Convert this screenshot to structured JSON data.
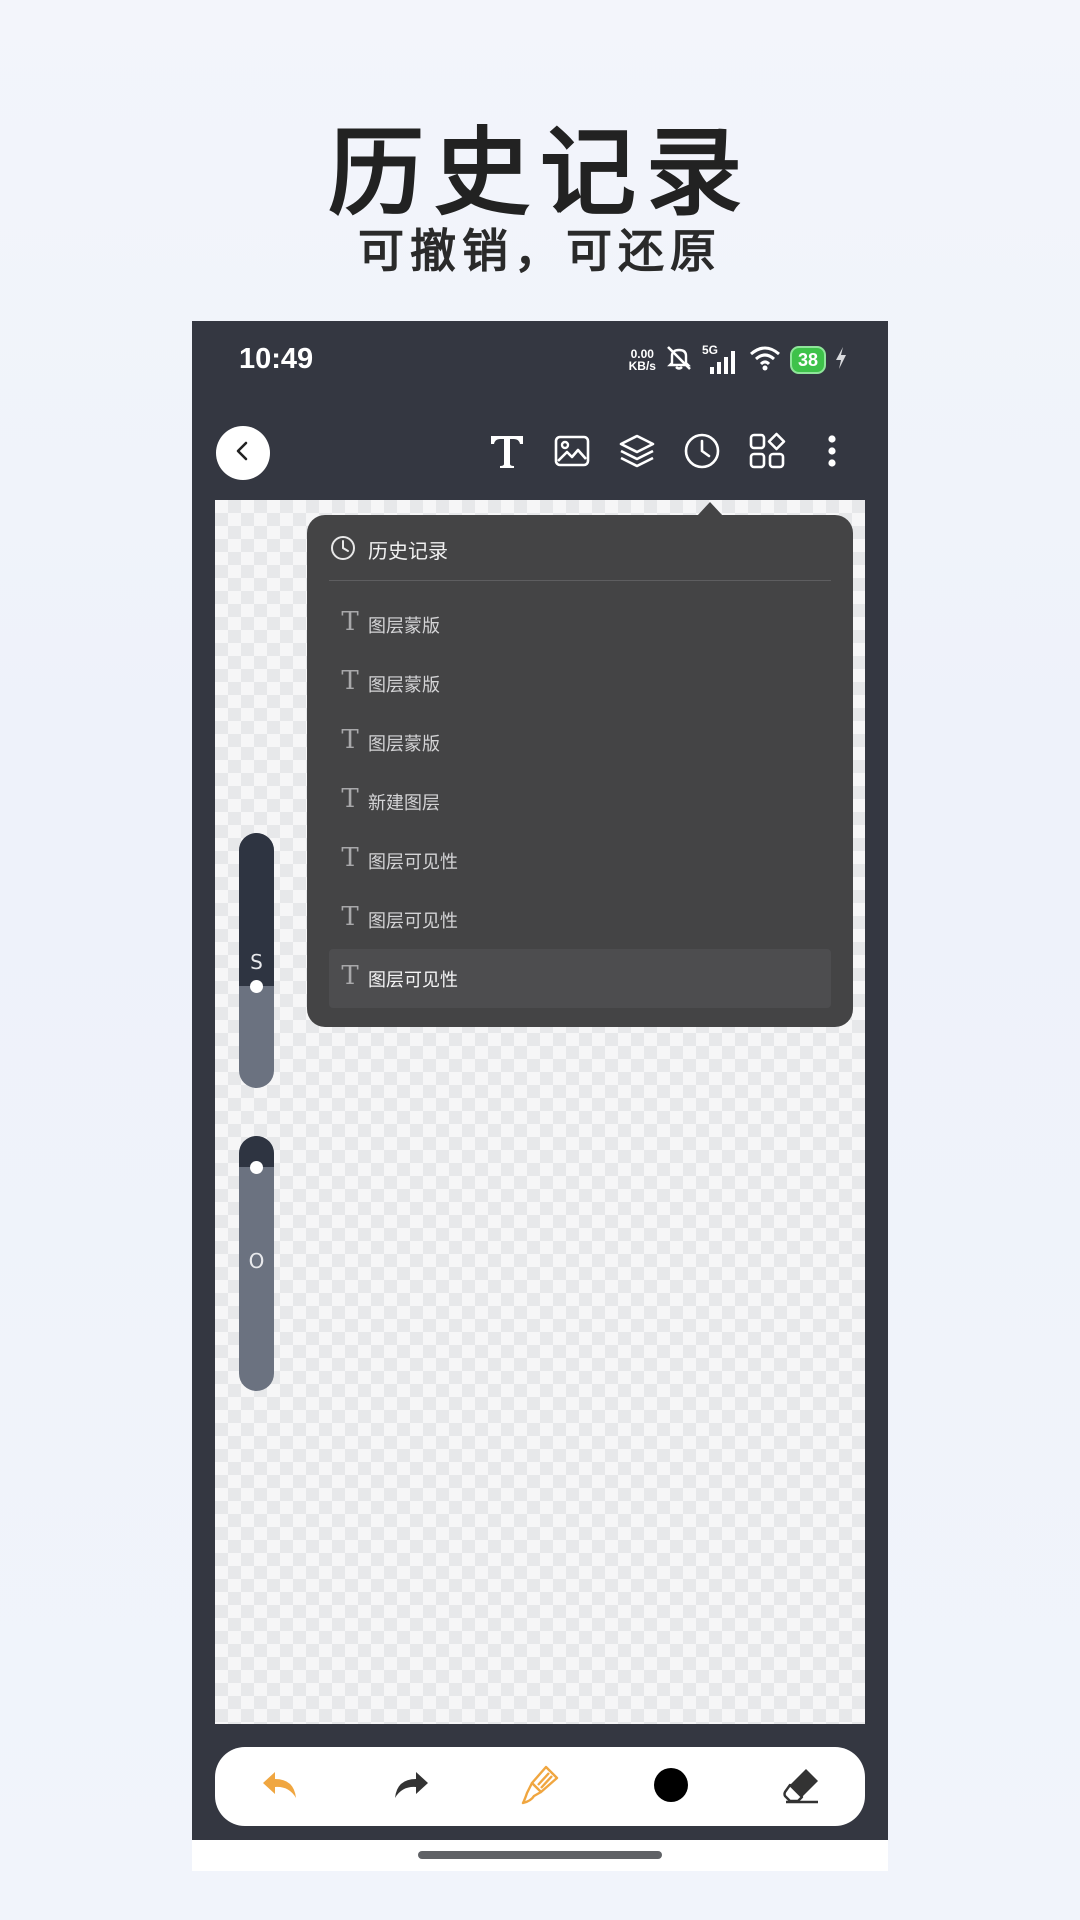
{
  "promo": {
    "title": "历史记录",
    "subtitle": "可撤销，可还原"
  },
  "status_bar": {
    "time": "10:49",
    "net_speed_value": "0.00",
    "net_speed_unit": "KB/s",
    "network_label": "5G",
    "battery": "38",
    "icons": [
      "mute-icon",
      "signal-icon",
      "wifi-icon",
      "battery-icon",
      "charging-icon"
    ]
  },
  "toolbar": {
    "icons": [
      "back-icon",
      "text-icon",
      "image-icon",
      "layers-icon",
      "history-icon",
      "apps-icon",
      "more-icon"
    ]
  },
  "sliders": {
    "size_label": "S",
    "opacity_label": "O",
    "size_level": 0.6,
    "opacity_level": 0.12
  },
  "history": {
    "title": "历史记录",
    "items": [
      {
        "label": "图层蒙版"
      },
      {
        "label": "图层蒙版"
      },
      {
        "label": "图层蒙版"
      },
      {
        "label": "新建图层"
      },
      {
        "label": "图层可见性"
      },
      {
        "label": "图层可见性"
      },
      {
        "label": "图层可见性"
      }
    ],
    "active_index": 6
  },
  "bottom_bar": {
    "icons": [
      "undo-icon",
      "redo-icon",
      "brush-icon",
      "color-icon",
      "eraser-icon"
    ],
    "undo_color": "#f0a640",
    "brush_color": "#f0a640",
    "current_color": "#000000"
  },
  "colors": {
    "app_bg": "#343741",
    "panel_bg": "#444445"
  }
}
